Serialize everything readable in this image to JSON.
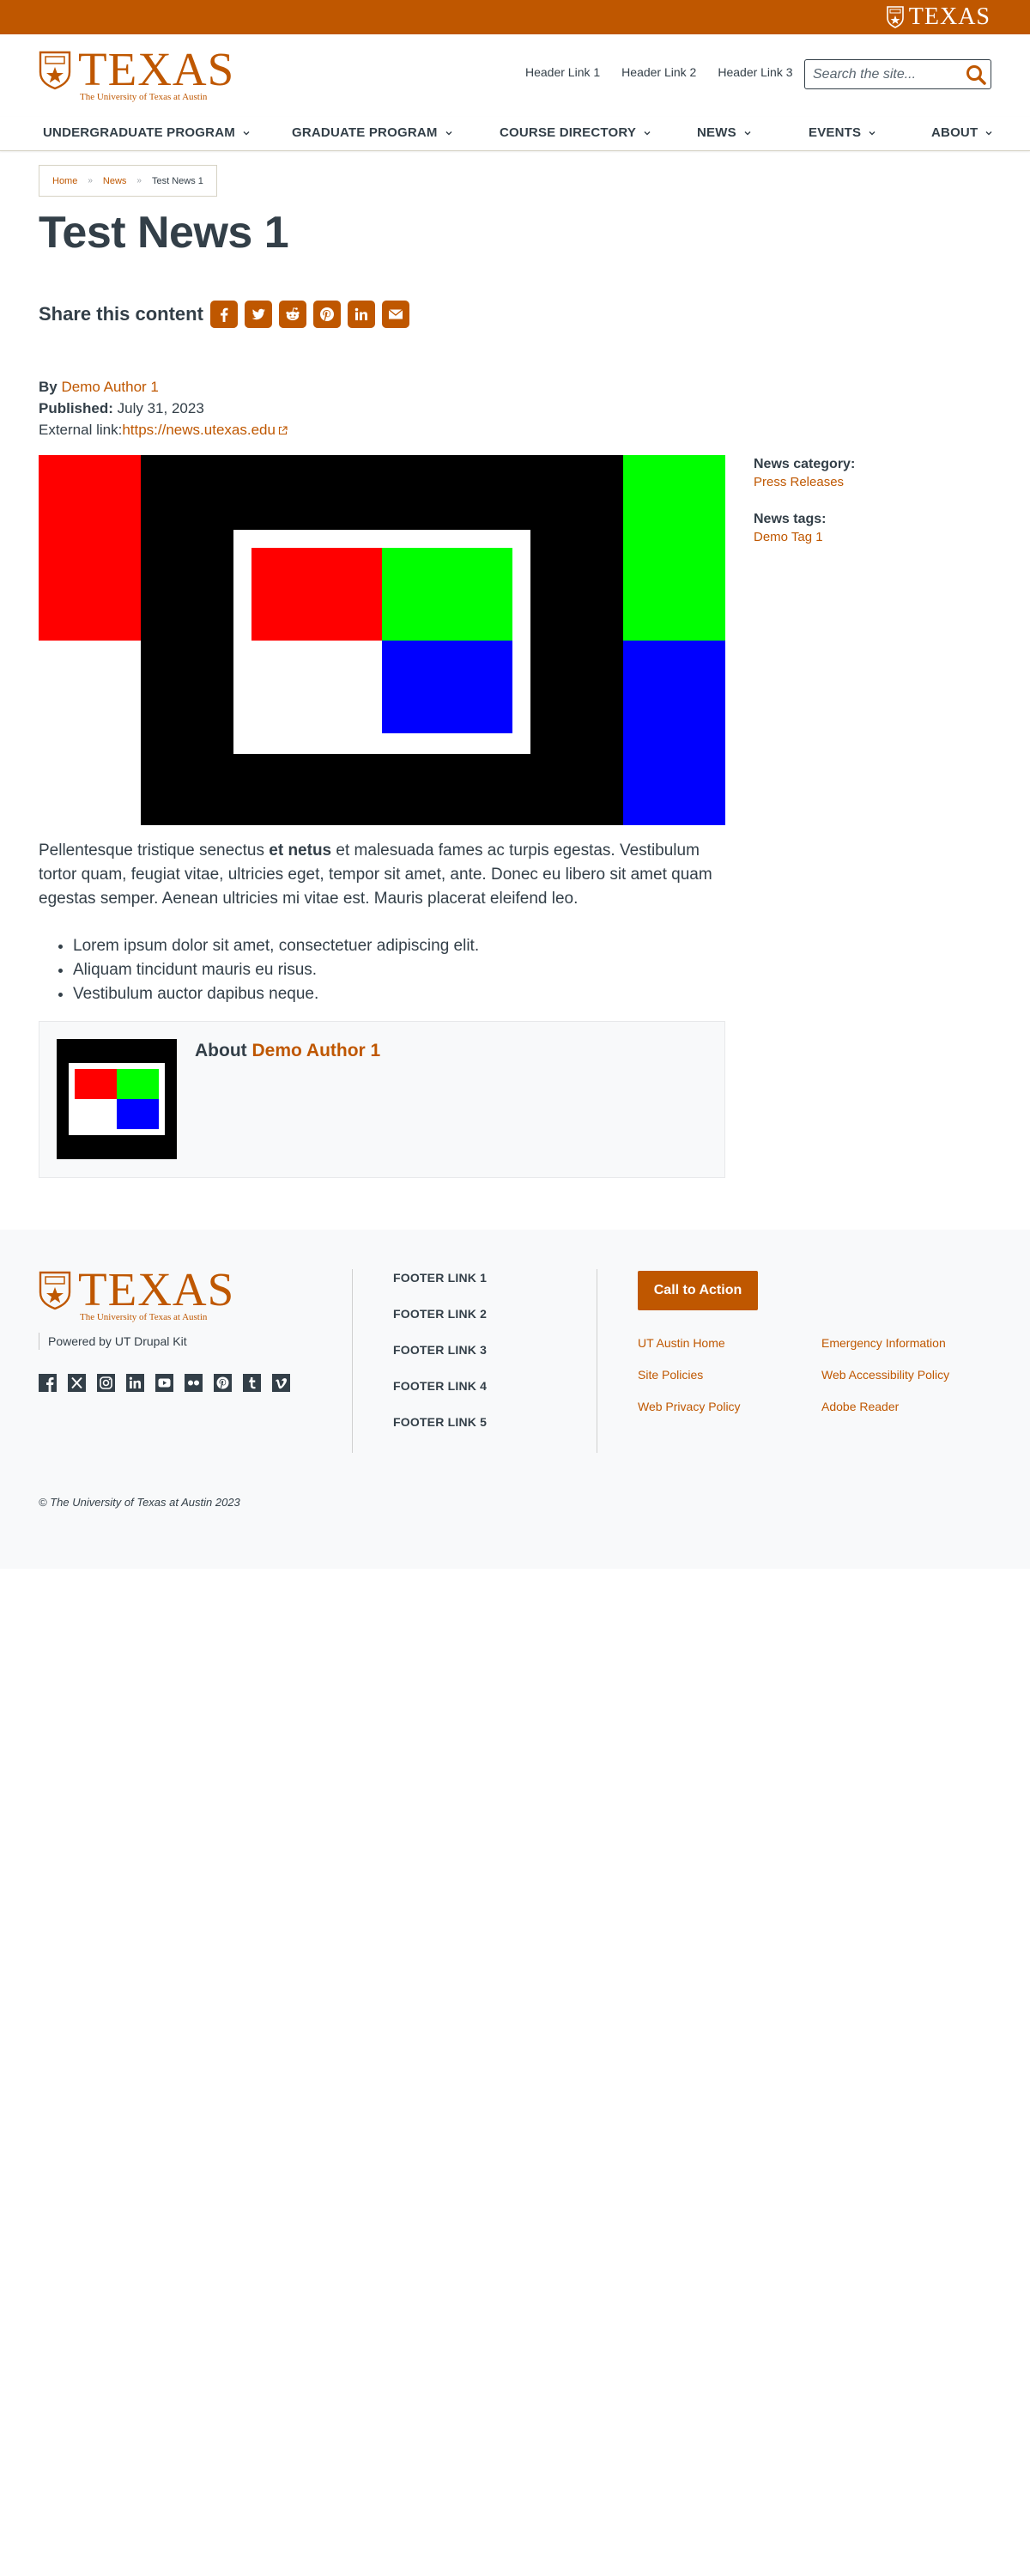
{
  "brand": {
    "wordmark": "TEXAS",
    "tagline": "The University of Texas at Austin",
    "color": "#bf5700"
  },
  "header": {
    "links": [
      "Header Link 1",
      "Header Link 2",
      "Header Link 3"
    ],
    "search_placeholder": "Search the site...",
    "search_icon": "search-icon"
  },
  "nav": {
    "items": [
      {
        "label": "UNDERGRADUATE PROGRAM"
      },
      {
        "label": "GRADUATE PROGRAM"
      },
      {
        "label": "COURSE DIRECTORY"
      },
      {
        "label": "NEWS"
      },
      {
        "label": "EVENTS"
      },
      {
        "label": "ABOUT"
      }
    ]
  },
  "breadcrumb": {
    "items": [
      "Home",
      "News"
    ],
    "current": "Test News 1"
  },
  "article": {
    "title": "Test News 1",
    "share_label": "Share this content",
    "share_services": [
      "facebook-icon",
      "twitter-icon",
      "reddit-icon",
      "pinterest-icon",
      "linkedin-icon",
      "email-icon"
    ],
    "by_label": "By",
    "author": "Demo Author 1",
    "published_label": "Published:",
    "published_date": "July 31, 2023",
    "external_label": "External link:",
    "external_url": "https://news.utexas.edu",
    "body_pre": "Pellentesque tristique senectus ",
    "body_bold": "et netus",
    "body_post": " et malesuada fames ac turpis egestas. Vestibulum tortor quam, feugiat vitae, ultricies eget, tempor sit amet, ante. Donec eu libero sit amet quam egestas semper. Aenean ultricies mi vitae est. Mauris placerat eleifend leo.",
    "bullets": [
      "Lorem ipsum dolor sit amet, consectetuer adipiscing elit.",
      "Aliquam tincidunt mauris eu risus.",
      "Vestibulum auctor dapibus neque."
    ],
    "about_label": "About",
    "about_author": "Demo Author 1"
  },
  "sidebar": {
    "category_label": "News category:",
    "category": "Press Releases",
    "tags_label": "News tags:",
    "tag": "Demo Tag 1"
  },
  "footer": {
    "powered_by": "Powered by UT Drupal Kit",
    "social": [
      "facebook-icon",
      "x-icon",
      "instagram-icon",
      "linkedin-icon",
      "youtube-icon",
      "flickr-icon",
      "pinterest-icon",
      "tumblr-icon",
      "vimeo-icon"
    ],
    "links": [
      "FOOTER LINK 1",
      "FOOTER LINK 2",
      "FOOTER LINK 3",
      "FOOTER LINK 4",
      "FOOTER LINK 5"
    ],
    "cta": "Call to Action",
    "resource_links": [
      "UT Austin Home",
      "Emergency Information",
      "Site Policies",
      "Web Accessibility Policy",
      "Web Privacy Policy",
      "Adobe Reader"
    ],
    "copyright": "© The University of Texas at Austin 2023"
  }
}
